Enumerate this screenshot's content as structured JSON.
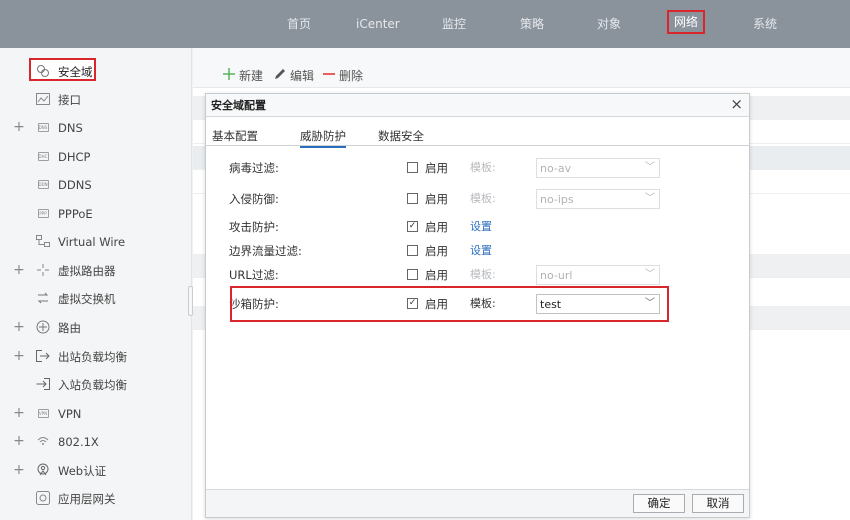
{
  "nav": {
    "items": [
      {
        "label": "首页"
      },
      {
        "label": "iCenter"
      },
      {
        "label": "监控"
      },
      {
        "label": "策略"
      },
      {
        "label": "对象"
      },
      {
        "label": "网络"
      },
      {
        "label": "系统"
      }
    ],
    "active": "网络"
  },
  "sidebar": {
    "items": [
      {
        "label": "安全域",
        "icon": "security-zone-icon",
        "selected": true
      },
      {
        "label": "接口",
        "icon": "interface-icon"
      },
      {
        "label": "DNS",
        "icon": "dns-icon",
        "expandable": true
      },
      {
        "label": "DHCP",
        "icon": "dhcp-icon"
      },
      {
        "label": "DDNS",
        "icon": "ddns-icon"
      },
      {
        "label": "PPPoE",
        "icon": "pppoe-icon"
      },
      {
        "label": "Virtual Wire",
        "icon": "virtual-wire-icon"
      },
      {
        "label": "虚拟路由器",
        "icon": "virtual-router-icon",
        "expandable": true
      },
      {
        "label": "虚拟交换机",
        "icon": "virtual-switch-icon"
      },
      {
        "label": "路由",
        "icon": "route-icon",
        "expandable": true
      },
      {
        "label": "出站负载均衡",
        "icon": "outbound-lb-icon",
        "expandable": true
      },
      {
        "label": "入站负载均衡",
        "icon": "inbound-lb-icon"
      },
      {
        "label": "VPN",
        "icon": "vpn-icon",
        "expandable": true
      },
      {
        "label": "802.1X",
        "icon": "wifi-icon",
        "expandable": true
      },
      {
        "label": "Web认证",
        "icon": "web-auth-icon",
        "expandable": true
      },
      {
        "label": "应用层网关",
        "icon": "alg-icon"
      }
    ],
    "expand_symbol": "+"
  },
  "toolbar": {
    "new_label": "新建",
    "edit_label": "编辑",
    "delete_label": "删除"
  },
  "dialog": {
    "title": "安全域配置",
    "close_symbol": "×",
    "tabs": [
      {
        "label": "基本配置"
      },
      {
        "label": "威胁防护",
        "active": true
      },
      {
        "label": "数据安全"
      }
    ],
    "rows": [
      {
        "label": "病毒过滤:",
        "checked": false,
        "enable": "启用",
        "kind": "template",
        "template_label": "模板:",
        "value": "no-av",
        "disabled": true
      },
      {
        "label": "入侵防御:",
        "checked": false,
        "enable": "启用",
        "kind": "template",
        "template_label": "模板:",
        "value": "no-ips",
        "disabled": true
      },
      {
        "label": "攻击防护:",
        "checked": true,
        "enable": "启用",
        "kind": "link",
        "link": "设置"
      },
      {
        "label": "边界流量过滤:",
        "checked": false,
        "enable": "启用",
        "kind": "link",
        "link": "设置"
      },
      {
        "label": "URL过滤:",
        "checked": false,
        "enable": "启用",
        "kind": "template",
        "template_label": "模板:",
        "value": "no-url",
        "disabled": true
      },
      {
        "label": "沙箱防护:",
        "checked": true,
        "enable": "启用",
        "kind": "template",
        "template_label": "模板:",
        "value": "test",
        "disabled": false
      }
    ],
    "ok_label": "确定",
    "cancel_label": "取消"
  },
  "colors": {
    "nav_bg": "#8a929c",
    "highlight": "#d9262c",
    "link": "#2a6ebd",
    "toolbar_new": "#4caf50",
    "toolbar_delete": "#e53935"
  }
}
